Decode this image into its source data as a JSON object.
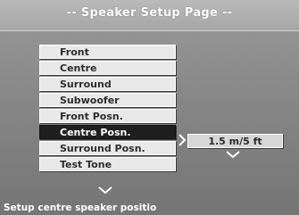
{
  "page": {
    "title": "-- Speaker Setup Page --"
  },
  "menu": {
    "items": [
      {
        "label": "Front",
        "selected": false
      },
      {
        "label": "Centre",
        "selected": false
      },
      {
        "label": "Surround",
        "selected": false
      },
      {
        "label": "Subwoofer",
        "selected": false
      },
      {
        "label": "Front Posn.",
        "selected": false
      },
      {
        "label": "Centre Posn.",
        "selected": true
      },
      {
        "label": "Surround Posn.",
        "selected": false
      },
      {
        "label": "Test Tone",
        "selected": false
      }
    ]
  },
  "submenu": {
    "value": "1.5 m/5 ft"
  },
  "status": {
    "text": "Setup centre speaker positio"
  },
  "colors": {
    "background": "#8f8f8f",
    "item_bg": "#e8e8e8",
    "selected_bg": "#1f1f1f",
    "text_light": "#ffffff",
    "text_dark": "#2d2d2d"
  },
  "icons": {
    "right_chevron": "chevron-right-icon",
    "down_chevron": "chevron-down-icon"
  }
}
